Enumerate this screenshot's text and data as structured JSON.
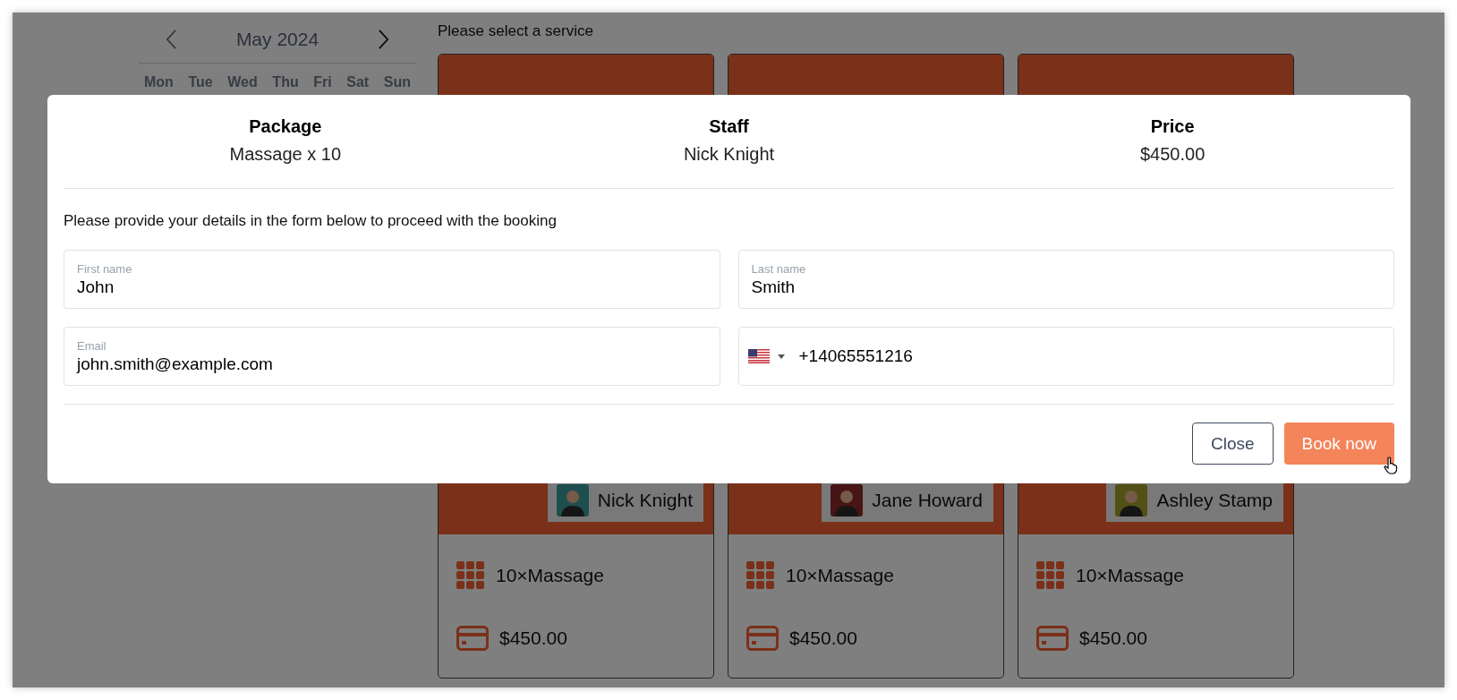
{
  "calendar": {
    "month": "May 2024",
    "weekdays": [
      "Mon",
      "Tue",
      "Wed",
      "Thu",
      "Fri",
      "Sat",
      "Sun"
    ]
  },
  "services": {
    "heading": "Please select a service",
    "cards": [
      {
        "staff": "Nick Knight",
        "package": "10×Massage",
        "price": "$450.00"
      },
      {
        "staff": "Jane Howard",
        "package": "10×Massage",
        "price": "$450.00"
      },
      {
        "staff": "Ashley Stamp",
        "package": "10×Massage",
        "price": "$450.00"
      }
    ]
  },
  "modal": {
    "summary": [
      {
        "label": "Package",
        "value": "Massage x 10"
      },
      {
        "label": "Staff",
        "value": "Nick Knight"
      },
      {
        "label": "Price",
        "value": "$450.00"
      }
    ],
    "instructions": "Please provide your details in the form below to proceed with the booking",
    "fields": [
      {
        "kind": "text",
        "label": "First name",
        "value": "John"
      },
      {
        "kind": "text",
        "label": "Last name",
        "value": "Smith"
      },
      {
        "kind": "text",
        "label": "Email",
        "value": "john.smith@example.com"
      },
      {
        "kind": "phone",
        "value": "+14065551216"
      }
    ],
    "buttons": [
      {
        "kind": "secondary",
        "label": "Close"
      },
      {
        "kind": "primary",
        "label": "Book now"
      }
    ]
  }
}
